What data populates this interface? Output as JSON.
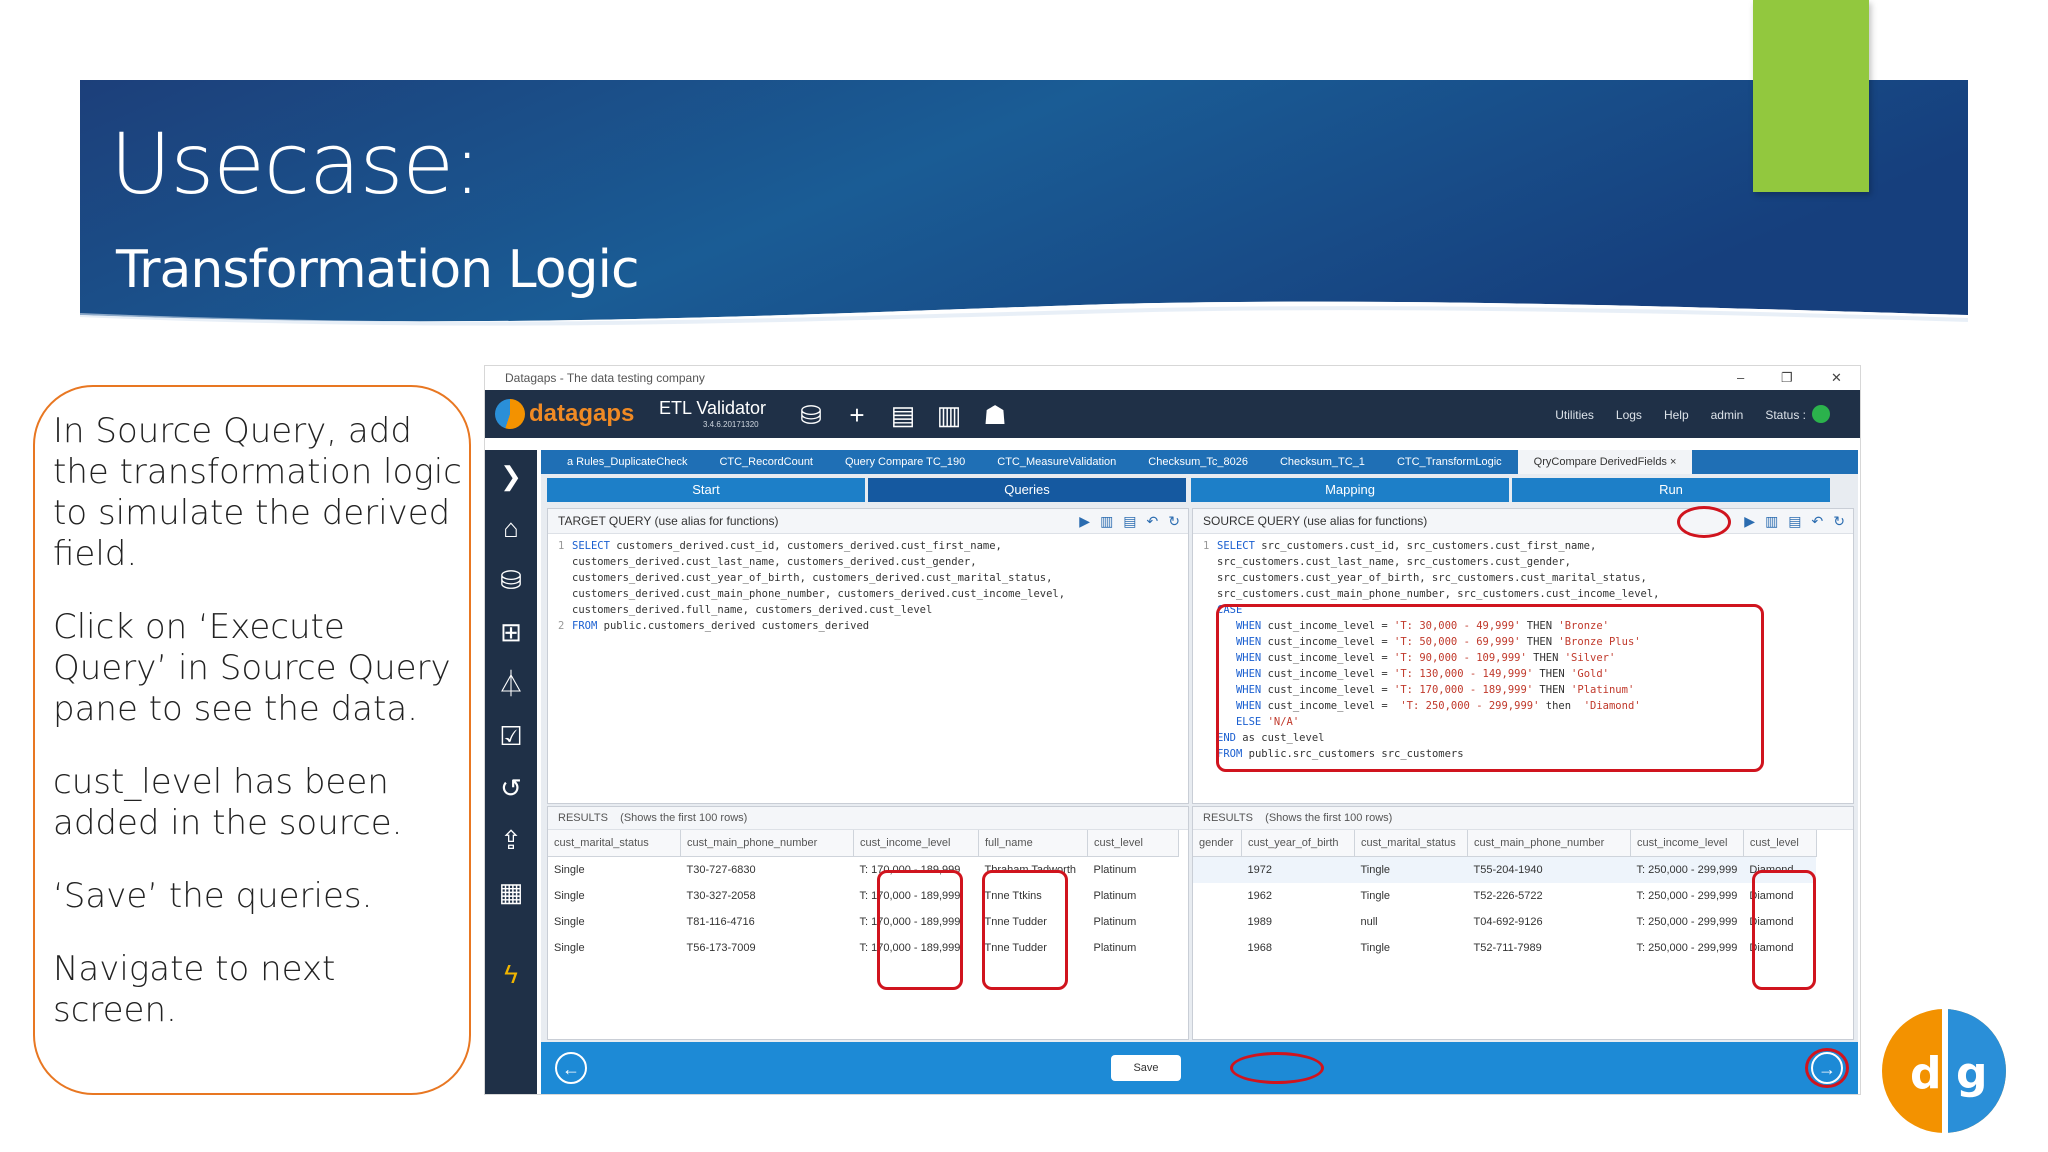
{
  "slide": {
    "title": "Usecase:",
    "subtitle": "Transformation Logic",
    "notes": [
      "In Source Query, add the transformation logic to simulate the derived field.",
      "Click on ‘Execute Query’ in Source Query pane to see the data.",
      "cust_level has been added in the source.",
      "‘Save’ the queries.",
      "Navigate to next screen."
    ],
    "colors": {
      "banner": "#1b4f8c",
      "accent": "#92c83e",
      "callout": "#e87722",
      "highlight": "#d0141e"
    }
  },
  "window": {
    "title": "Datagaps - The data testing company",
    "controls": [
      "–",
      "❐",
      "✕"
    ]
  },
  "app": {
    "logo": "datagaps",
    "product": "ETL Validator",
    "version": "3.4.6.20171320",
    "menu": [
      "Utilities",
      "Logs",
      "Help",
      "admin",
      "Status :"
    ],
    "tabs": [
      "a Rules_DuplicateCheck",
      "CTC_RecordCount",
      "Query Compare TC_190",
      "CTC_MeasureValidation",
      "Checksum_Tc_8026",
      "Checksum_TC_1",
      "CTC_TransformLogic",
      "QryCompare DerivedFields"
    ],
    "tab_close": "×",
    "steps": [
      "Start",
      "Queries",
      "Mapping",
      "Run"
    ],
    "target": {
      "title": "TARGET QUERY (use alias for functions)",
      "results_label": "RESULTS",
      "results_note": "(Shows the first 100 rows)",
      "columns": [
        "cust_marital_status",
        "cust_main_phone_number",
        "cust_income_level",
        "full_name",
        "cust_level"
      ],
      "rows": [
        [
          "Single",
          "T30-727-6830",
          "T: 170,000 - 189,999",
          "Tbraham Tadworth",
          "Platinum"
        ],
        [
          "Single",
          "T30-327-2058",
          "T: 170,000 - 189,999",
          "Tnne Ttkins",
          "Platinum"
        ],
        [
          "Single",
          "T81-116-4716",
          "T: 170,000 - 189,999",
          "Tnne Tudder",
          "Platinum"
        ],
        [
          "Single",
          "T56-173-7009",
          "T: 170,000 - 189,999",
          "Tnne Tudder",
          "Platinum"
        ]
      ]
    },
    "source": {
      "title": "SOURCE QUERY (use alias for functions)",
      "results_label": "RESULTS",
      "results_note": "(Shows the first 100 rows)",
      "columns": [
        "gender",
        "cust_year_of_birth",
        "cust_marital_status",
        "cust_main_phone_number",
        "cust_income_level",
        "cust_level"
      ],
      "rows": [
        [
          "",
          "1972",
          "Tingle",
          "T55-204-1940",
          "T: 250,000 - 299,999",
          "Diamond"
        ],
        [
          "",
          "1962",
          "Tingle",
          "T52-226-5722",
          "T: 250,000 - 299,999",
          "Diamond"
        ],
        [
          "",
          "1989",
          "null",
          "T04-692-9126",
          "T: 250,000 - 299,999",
          "Diamond"
        ],
        [
          "",
          "1968",
          "Tingle",
          "T52-711-7989",
          "T: 250,000 - 299,999",
          "Diamond"
        ]
      ]
    },
    "footer": {
      "save_label": "Save",
      "back_icon": "←",
      "next_icon": "→"
    }
  }
}
